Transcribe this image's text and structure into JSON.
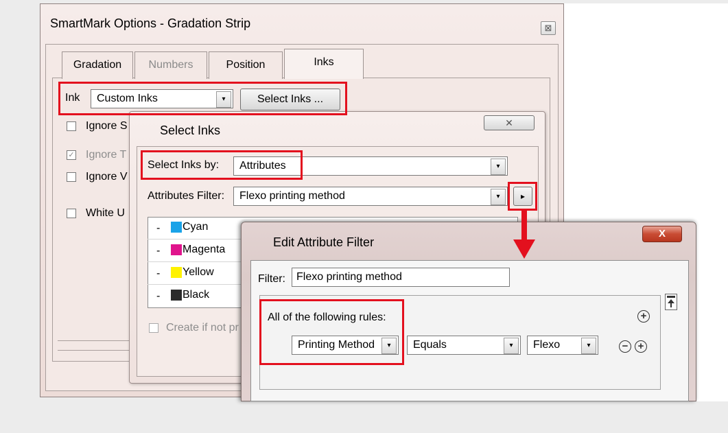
{
  "main_dialog": {
    "title": "SmartMark Options - Gradation Strip",
    "close_glyph": "⊠",
    "tabs": [
      {
        "label": "Gradation",
        "state": "normal"
      },
      {
        "label": "Numbers",
        "state": "disabled"
      },
      {
        "label": "Position",
        "state": "normal"
      },
      {
        "label": "Inks",
        "state": "active"
      }
    ],
    "ink_label": "Ink",
    "ink_value": "Custom Inks",
    "select_inks_button": "Select Inks ...",
    "checkboxes": [
      {
        "label": "Ignore S",
        "checked": false,
        "disabled": false
      },
      {
        "label": "Ignore T",
        "checked": true,
        "disabled": true
      },
      {
        "label": "Ignore V",
        "checked": false,
        "disabled": false
      },
      {
        "label": "White U",
        "checked": false,
        "disabled": false
      }
    ],
    "check_glyph": "✓"
  },
  "select_inks_dialog": {
    "title": "Select Inks",
    "close_glyph": "✕",
    "select_by_label": "Select Inks by:",
    "select_by_value": "Attributes",
    "filter_label": "Attributes Filter:",
    "filter_value": "Flexo printing method",
    "flyout_glyph": "▸",
    "inks": [
      {
        "name": "Cyan",
        "color": "#1aa3e8"
      },
      {
        "name": "Magenta",
        "color": "#e0148c"
      },
      {
        "name": "Yellow",
        "color": "#fff200"
      },
      {
        "name": "Black",
        "color": "#2b2b2b"
      }
    ],
    "ink_prefix": "-",
    "create_checkbox_label": "Create if not pr"
  },
  "edit_filter_dialog": {
    "title": "Edit Attribute Filter",
    "close_glyph": "X",
    "filter_label": "Filter:",
    "filter_value": "Flexo printing method",
    "rules_label": "All of the following rules:",
    "rule": {
      "attribute": "Printing Method",
      "operator": "Equals",
      "value": "Flexo"
    },
    "add_glyph": "+",
    "remove_glyph": "−"
  },
  "arrow_glyph": "▾",
  "colors": {
    "highlight_red": "#e3101e"
  }
}
